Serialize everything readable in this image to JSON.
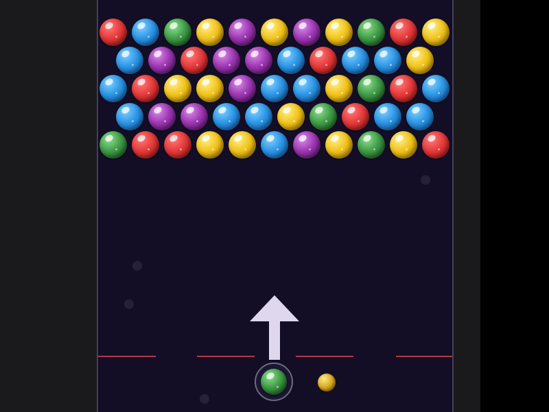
{
  "game": {
    "bubble_grid": [
      [
        "red",
        "blue",
        "green",
        "yellow",
        "purple",
        "yellow",
        "purple",
        "yellow",
        "green",
        "red",
        "yellow"
      ],
      [
        "blue",
        "purple",
        "red",
        "purple",
        "purple",
        "blue",
        "red",
        "blue",
        "blue",
        "yellow"
      ],
      [
        "blue",
        "red",
        "yellow",
        "yellow",
        "purple",
        "blue",
        "blue",
        "yellow",
        "green",
        "red",
        "blue"
      ],
      [
        "blue",
        "purple",
        "purple",
        "blue",
        "blue",
        "yellow",
        "green",
        "red",
        "blue",
        "blue"
      ],
      [
        "green",
        "red",
        "red",
        "yellow",
        "yellow",
        "blue",
        "purple",
        "yellow",
        "green",
        "yellow",
        "red"
      ]
    ],
    "current_bubble": "green",
    "next_bubble": "yellow",
    "aim_direction": "up"
  },
  "colors": {
    "board_background": "#130e26",
    "deadline": "#b23a44",
    "arrow": "#ded7ee"
  }
}
